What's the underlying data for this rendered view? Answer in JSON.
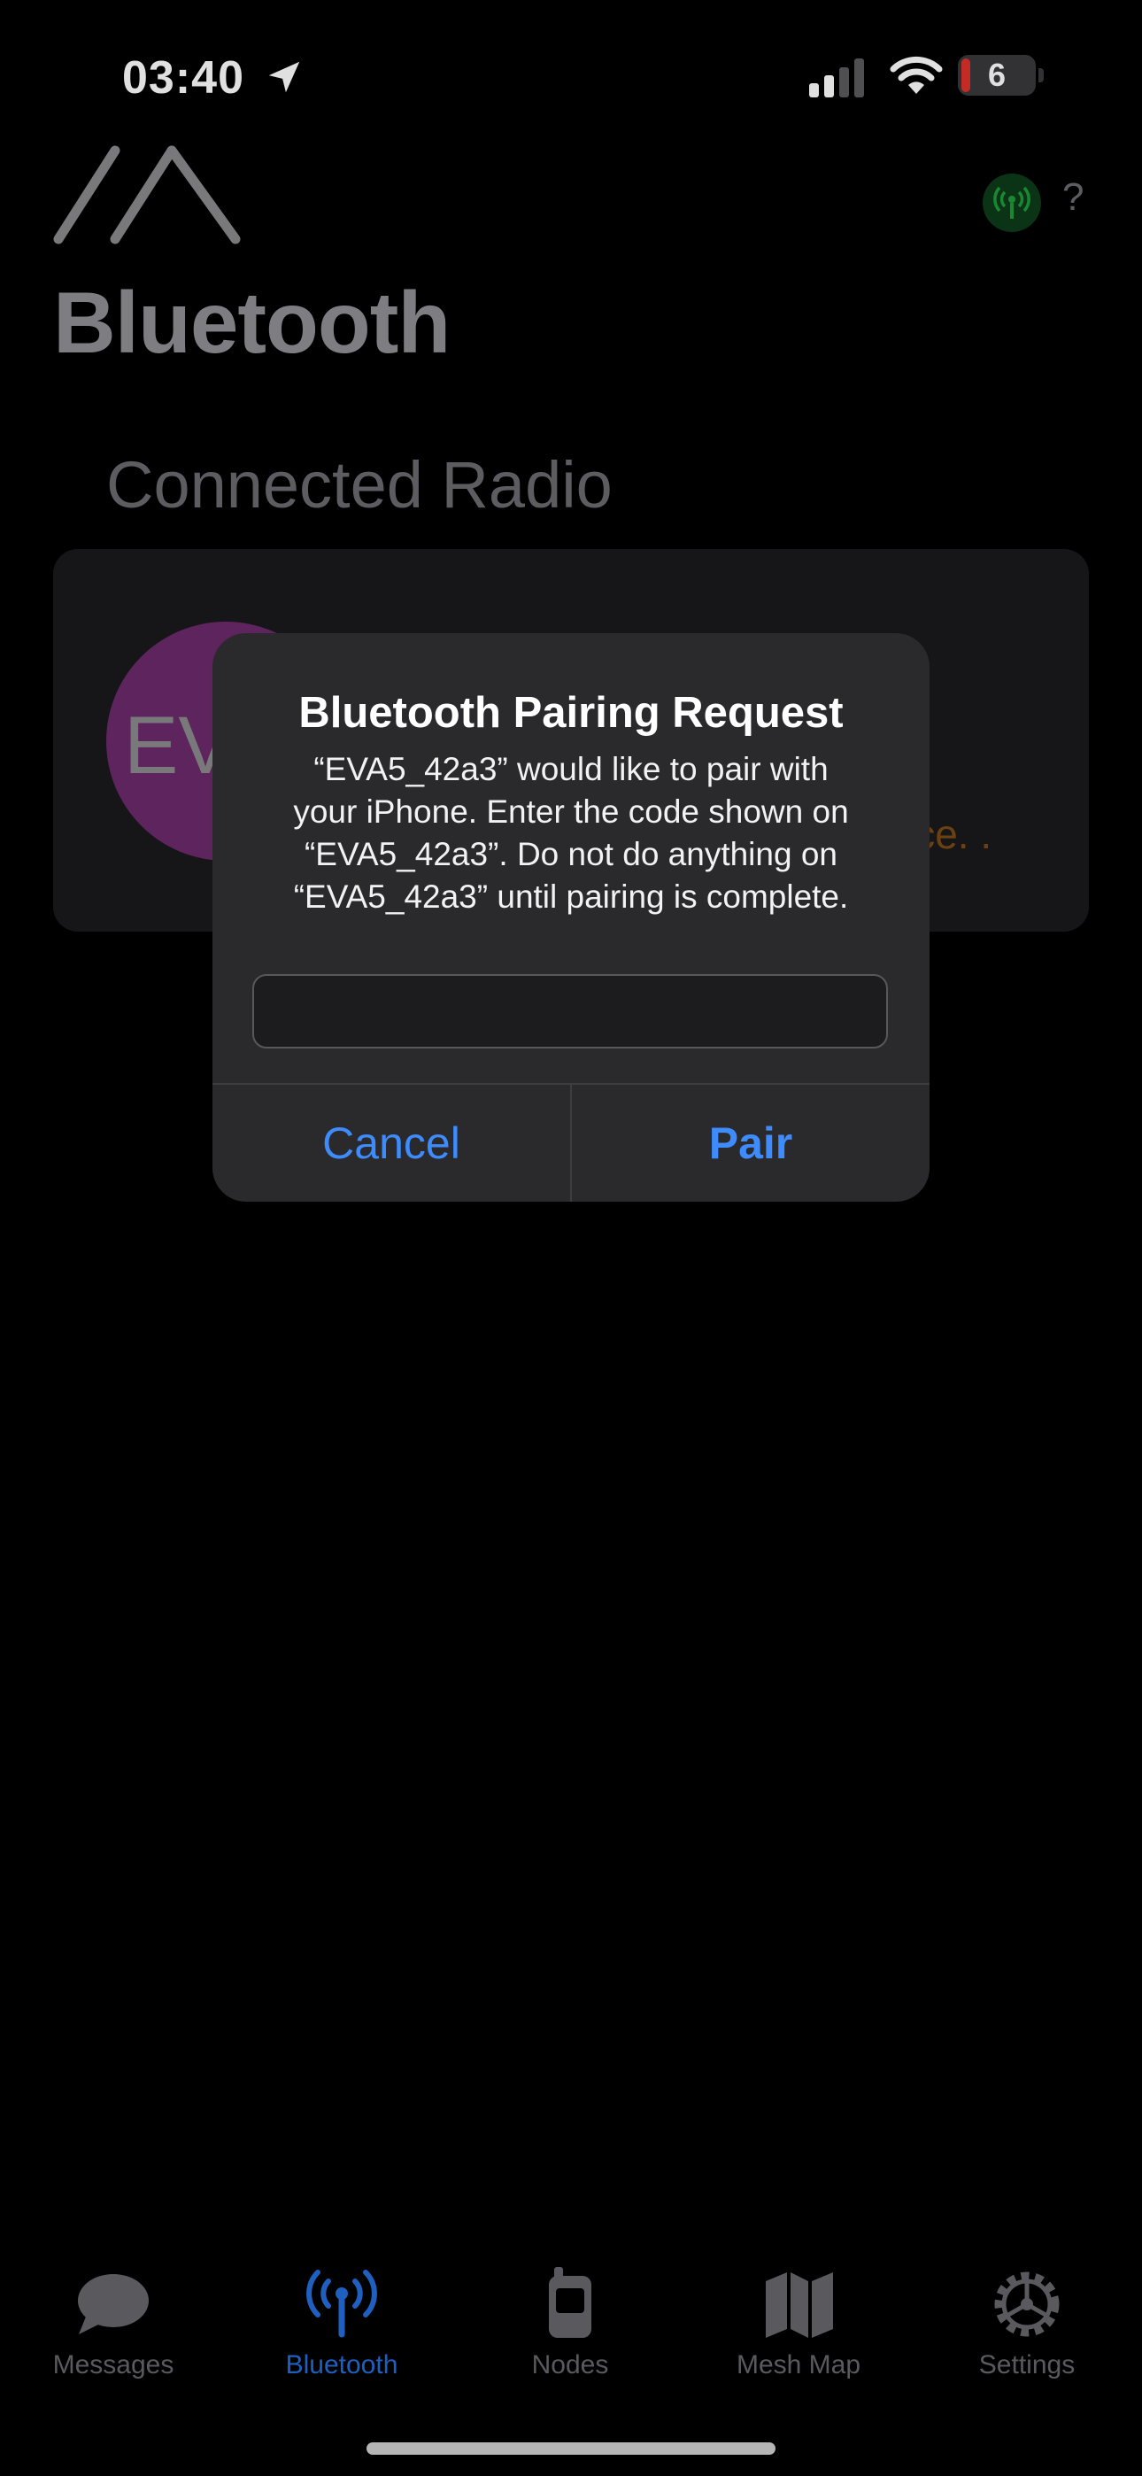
{
  "status_bar": {
    "time": "03:40",
    "battery": "6"
  },
  "header": {
    "title": "Bluetooth",
    "help": "?"
  },
  "connected_radio": {
    "section_title": "Connected Radio",
    "avatar_text": "EV",
    "status_text": "vice. ."
  },
  "alert": {
    "title": "Bluetooth Pairing Request",
    "message": "“EVA5_42a3” would like to pair with\nyour iPhone. Enter the code shown on\n“EVA5_42a3”. Do not do anything on\n“EVA5_42a3” until pairing is complete.",
    "input_value": "",
    "cancel_label": "Cancel",
    "pair_label": "Pair"
  },
  "tabs": [
    {
      "label": "Messages",
      "icon": "messages-bubble-icon",
      "active": false
    },
    {
      "label": "Bluetooth",
      "icon": "antenna-icon",
      "active": true
    },
    {
      "label": "Nodes",
      "icon": "radio-device-icon",
      "active": false
    },
    {
      "label": "Mesh Map",
      "icon": "map-icon",
      "active": false
    },
    {
      "label": "Settings",
      "icon": "gear-icon",
      "active": false
    }
  ],
  "colors": {
    "accent": "#3d8bfd",
    "active_tab": "#1f5fbf",
    "avatar": "#6a2a6c",
    "status_warning": "#7a4a14",
    "antenna_badge": "#0d3b18"
  }
}
